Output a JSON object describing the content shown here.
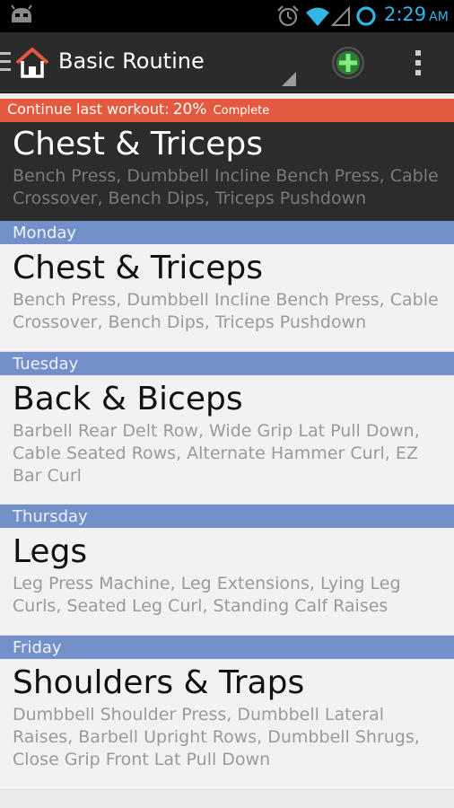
{
  "status_bar": {
    "time": "2:29",
    "ampm": "AM",
    "icons": [
      "android-icon",
      "alarm-icon",
      "wifi-icon",
      "signal-icon",
      "sync-icon"
    ],
    "accent_color": "#33b5e5"
  },
  "action_bar": {
    "title": "Basic Routine",
    "icons": [
      "drawer-icon",
      "home-logo-icon",
      "spinner-icon",
      "add-icon",
      "overflow-icon"
    ]
  },
  "continue_banner": {
    "label": "Continue last workout:",
    "percent": "20%",
    "suffix": "Complete",
    "color": "#e35a3e"
  },
  "current_workout": {
    "title": "Chest & Triceps",
    "exercises": "Bench Press, Dumbbell Incline Bench Press, Cable Crossover, Bench Dips, Triceps Pushdown"
  },
  "days": [
    {
      "day": "Monday",
      "title": "Chest & Triceps",
      "exercises": "Bench Press, Dumbbell Incline Bench Press, Cable Crossover, Bench Dips, Triceps Pushdown"
    },
    {
      "day": "Tuesday",
      "title": "Back & Biceps",
      "exercises": "Barbell Rear Delt Row, Wide Grip Lat Pull Down, Cable Seated Rows, Alternate Hammer Curl, EZ Bar Curl"
    },
    {
      "day": "Thursday",
      "title": "Legs",
      "exercises": "Leg Press Machine, Leg Extensions, Lying Leg Curls, Seated Leg Curl, Standing Calf Raises"
    },
    {
      "day": "Friday",
      "title": "Shoulders & Traps",
      "exercises": "Dumbbell Shoulder Press, Dumbbell Lateral Raises, Barbell Upright Rows, Dumbbell Shrugs, Close Grip Front Lat Pull Down"
    }
  ],
  "colors": {
    "day_header": "#7391c8",
    "action_bar": "#2b2b2b"
  }
}
